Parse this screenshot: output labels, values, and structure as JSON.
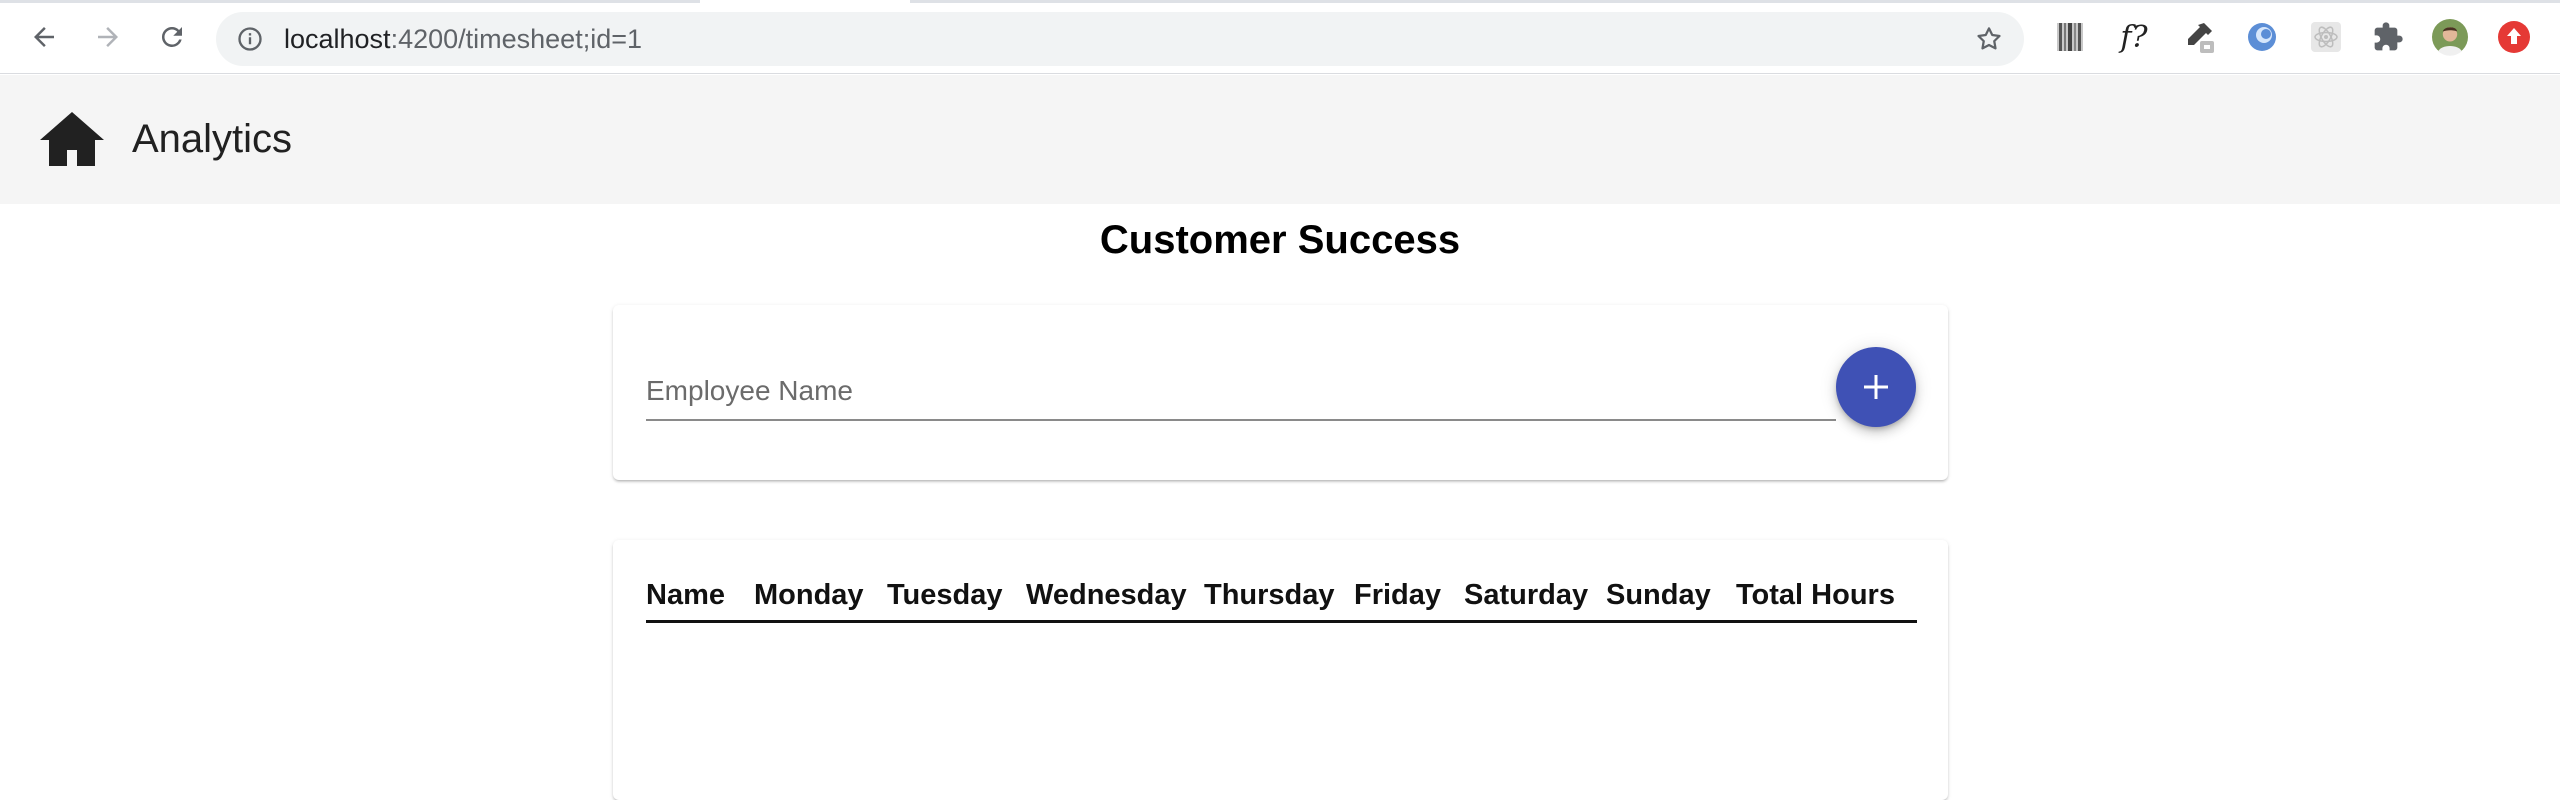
{
  "browser": {
    "url_host": "localhost",
    "url_path": ":4200/timesheet;id=1",
    "extensions": [
      "barcode-icon",
      "formula-extension-icon",
      "eyedropper-icon",
      "circle-extension-icon",
      "react-devtools-icon",
      "puzzle-icon",
      "profile-avatar",
      "update-icon"
    ],
    "formula_label": "f?"
  },
  "toolbar": {
    "title": "Analytics",
    "icon": "home-icon"
  },
  "page": {
    "heading": "Customer Success"
  },
  "form": {
    "employee_name_placeholder": "Employee Name",
    "employee_name_value": "",
    "add_button_icon": "add-icon"
  },
  "table": {
    "columns": [
      "Name",
      "Monday",
      "Tuesday",
      "Wednesday",
      "Thursday",
      "Friday",
      "Saturday",
      "Sunday",
      "Total Hours"
    ],
    "rows": []
  },
  "colors": {
    "accent": "#3f51b5",
    "toolbar_bg": "#f5f5f5",
    "update_badge": "#e53935"
  }
}
